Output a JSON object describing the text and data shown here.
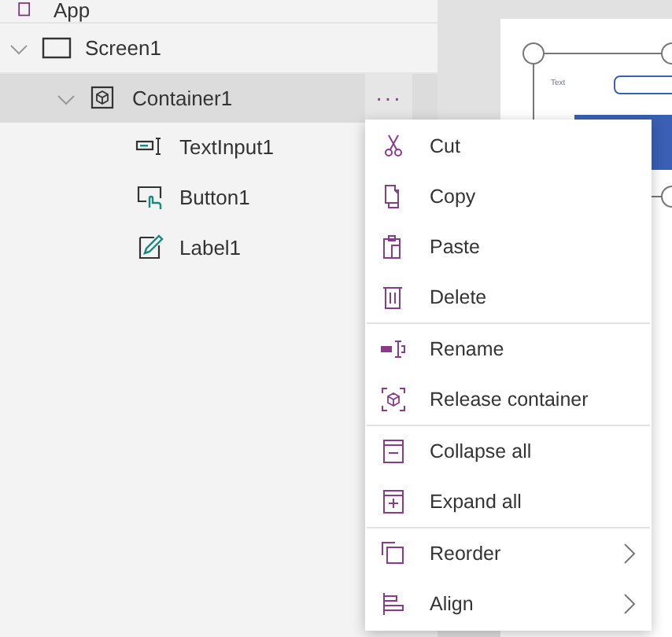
{
  "tree": [
    {
      "label": "App",
      "kind": "app",
      "selected": false
    },
    {
      "label": "Screen1",
      "kind": "screen",
      "selected": false,
      "expanded": true,
      "children": [
        {
          "label": "Container1",
          "kind": "container",
          "selected": true,
          "expanded": true,
          "more": "···",
          "children": [
            {
              "label": "TextInput1",
              "kind": "textinput",
              "selected": false
            },
            {
              "label": "Button1",
              "kind": "button",
              "selected": false
            },
            {
              "label": "Label1",
              "kind": "label",
              "selected": false
            }
          ]
        }
      ]
    }
  ],
  "canvas": {
    "text_label": "Text"
  },
  "context_menu": [
    [
      {
        "label": "Cut"
      },
      {
        "label": "Copy"
      },
      {
        "label": "Paste"
      },
      {
        "label": "Delete"
      }
    ],
    [
      {
        "label": "Rename"
      },
      {
        "label": "Release container"
      }
    ],
    [
      {
        "label": "Collapse all"
      },
      {
        "label": "Expand all"
      }
    ],
    [
      {
        "label": "Reorder",
        "submenu": true
      },
      {
        "label": "Align",
        "submenu": true
      }
    ]
  ]
}
